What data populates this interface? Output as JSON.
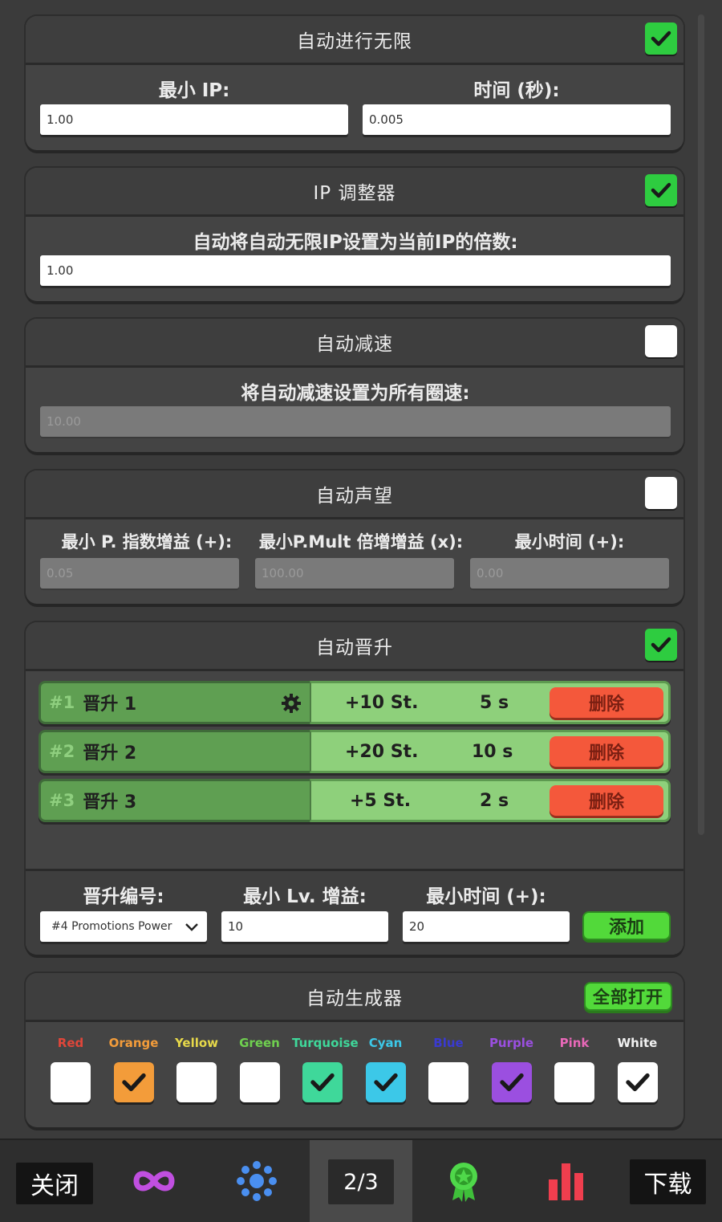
{
  "auto_infinity": {
    "title": "自动进行无限",
    "enabled": true,
    "min_ip_label": "最小 IP:",
    "time_label": "时间 (秒):",
    "min_ip_value": "1.00",
    "time_value": "0.005"
  },
  "ip_adjuster": {
    "title": "IP 调整器",
    "enabled": true,
    "label": "自动将自动无限IP设置为当前IP的倍数:",
    "value": "1.00"
  },
  "auto_slowdown": {
    "title": "自动减速",
    "enabled": false,
    "label": "将自动减速设置为所有圈速:",
    "value": "10.00"
  },
  "auto_prestige": {
    "title": "自动声望",
    "enabled": false,
    "labels": [
      "最小 P. 指数增益 (+):",
      "最小P.Mult 倍增增益 (x):",
      "最小时间 (+):"
    ],
    "values": [
      "0.05",
      "100.00",
      "0.00"
    ]
  },
  "auto_promotion": {
    "title": "自动晋升",
    "enabled": true,
    "rows": [
      {
        "num": "#1",
        "name": "晋升 1",
        "stages": "+10 St.",
        "time": "5 s",
        "delete": "删除"
      },
      {
        "num": "#2",
        "name": "晋升 2",
        "stages": "+20 St.",
        "time": "10 s",
        "delete": "删除"
      },
      {
        "num": "#3",
        "name": "晋升 3",
        "stages": "+5 St.",
        "time": "2 s",
        "delete": "删除"
      }
    ],
    "promo_number_label": "晋升编号:",
    "min_lv_label": "最小 Lv. 增益:",
    "min_time_label": "最小时间 (+):",
    "dropdown_value": "#4 Promotions Power",
    "min_lv_value": "10",
    "min_time_value": "20",
    "add_label": "添加"
  },
  "auto_generator": {
    "title": "自动生成器",
    "open_all_label": "全部打开",
    "colors": [
      {
        "name": "Red",
        "color": "#e0463a",
        "checked": false,
        "box": "#ffffff"
      },
      {
        "name": "Orange",
        "color": "#f39c3a",
        "checked": true,
        "box": "#f39c3a"
      },
      {
        "name": "Yellow",
        "color": "#e6d84a",
        "checked": false,
        "box": "#ffffff"
      },
      {
        "name": "Green",
        "color": "#6fcf4f",
        "checked": false,
        "box": "#ffffff"
      },
      {
        "name": "Turquoise",
        "color": "#3fd89a",
        "checked": true,
        "box": "#3fd89a"
      },
      {
        "name": "Cyan",
        "color": "#3cc8e8",
        "checked": true,
        "box": "#3cc8e8"
      },
      {
        "name": "Blue",
        "color": "#3a3ad0",
        "checked": false,
        "box": "#ffffff"
      },
      {
        "name": "Purple",
        "color": "#9b4fe0",
        "checked": true,
        "box": "#9b4fe0"
      },
      {
        "name": "Pink",
        "color": "#e868b8",
        "checked": false,
        "box": "#ffffff"
      },
      {
        "name": "White",
        "color": "#f2f2f2",
        "checked": true,
        "box": "#ffffff"
      }
    ]
  },
  "tabbar": {
    "close_label": "关闭",
    "page_label": "2/3",
    "download_label": "下载",
    "tabs": [
      "infinity-icon",
      "gear-dots-icon",
      "robot-icon",
      "award-icon",
      "bar-chart-icon"
    ]
  }
}
